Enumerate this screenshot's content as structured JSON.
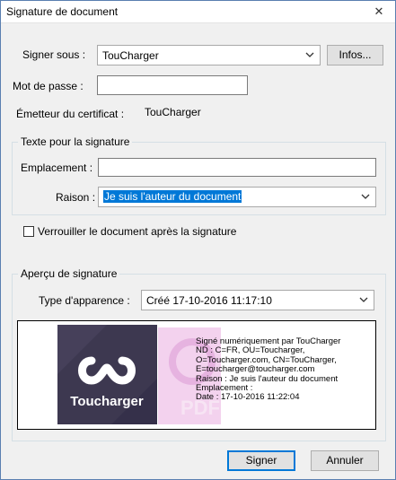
{
  "window": {
    "title": "Signature de document",
    "close_glyph": "✕"
  },
  "sign_as": {
    "label": "Signer sous :",
    "value": "TouCharger",
    "info_button": "Infos..."
  },
  "password": {
    "label": "Mot de passe :",
    "value": ""
  },
  "issuer": {
    "label": "Émetteur du certificat :",
    "value": "TouCharger"
  },
  "signature_text_group": {
    "legend": "Texte pour la signature",
    "location_label": "Emplacement :",
    "location_value": "",
    "reason_label": "Raison :",
    "reason_value": "Je suis l'auteur du document"
  },
  "lock_checkbox": {
    "label": "Verrouiller le document après la signature",
    "checked": false
  },
  "preview_group": {
    "legend": "Aperçu de signature",
    "appearance_label": "Type d'apparence :",
    "appearance_value": "Créé 17-10-2016 11:17:10",
    "logo_text": "Toucharger",
    "watermark_text": "PDF",
    "signature_lines": [
      "Signé numériquement par TouCharger",
      "ND : C=FR, OU=Toucharger,",
      "O=Toucharger.com, CN=TouCharger,",
      "E=toucharger@toucharger.com",
      "Raison : Je suis l'auteur du document",
      "Emplacement :",
      "Date : 17-10-2016 11:22:04"
    ]
  },
  "buttons": {
    "sign": "Signer",
    "cancel": "Annuler"
  },
  "colors": {
    "accent": "#0078d7",
    "logo_bg": "#3d3850",
    "watermark": "#e6b3e0"
  },
  "icons": {
    "close": "close-icon",
    "dropdown": "chevron-down-icon",
    "logo": "toucharger-logo"
  }
}
